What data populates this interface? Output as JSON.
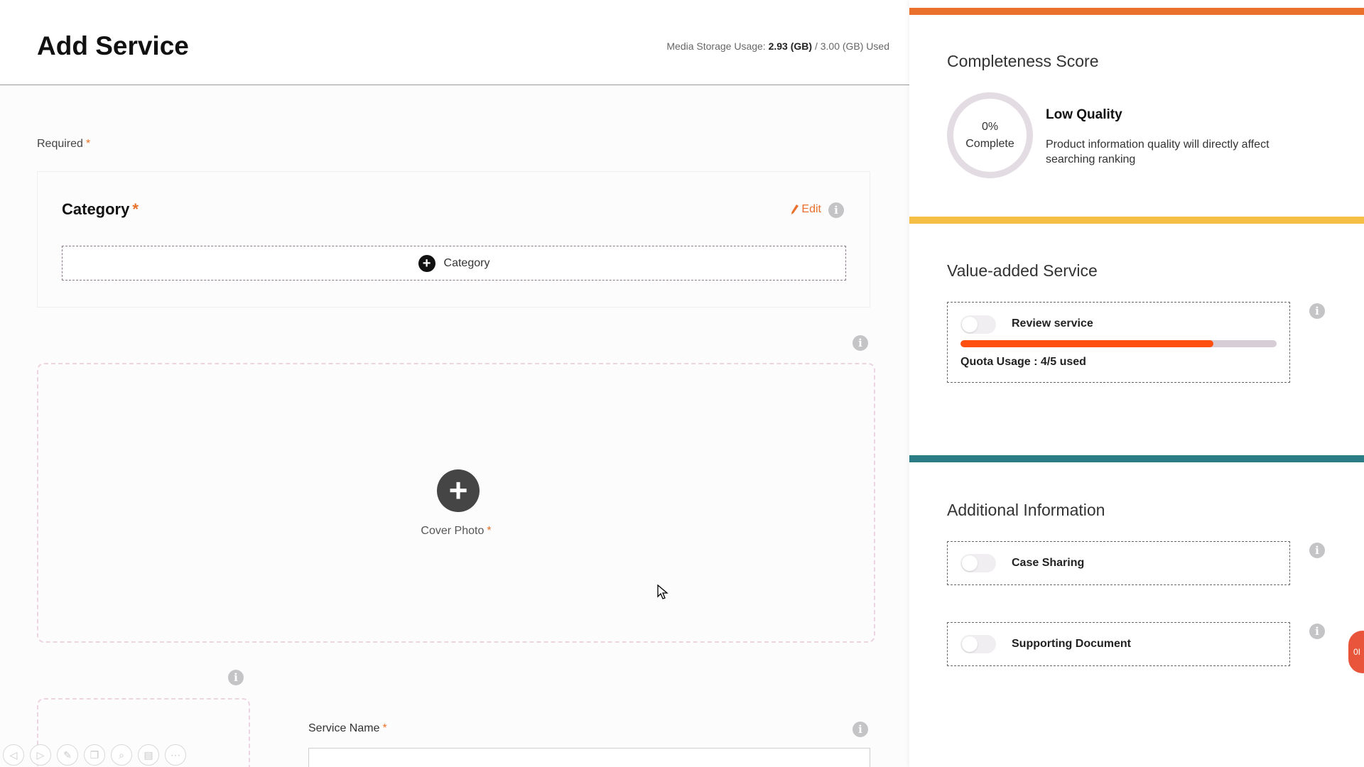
{
  "header": {
    "title": "Add Service",
    "storage_label": "Media Storage Usage: ",
    "storage_used": "2.93 (GB)",
    "storage_total": " / 3.00 (GB) Used"
  },
  "form": {
    "required_label": "Required",
    "required_star": "*",
    "category": {
      "title": "Category",
      "edit_label": "Edit",
      "add_label": "Category"
    },
    "cover_photo_label": "Cover Photo",
    "service_name_label": "Service Name"
  },
  "icons": {
    "info": "info-icon",
    "plus": "plus-icon",
    "pencil": "pencil-icon"
  },
  "sidebar": {
    "completeness": {
      "title": "Completeness Score",
      "percent": "0%",
      "complete_label": "Complete",
      "quality_title": "Low Quality",
      "quality_desc": "Product information quality will directly affect searching ranking"
    },
    "value_added": {
      "title": "Value-added Service",
      "review_label": "Review service",
      "quota_text": "Quota Usage : 4/5 used",
      "quota_fraction": 0.8
    },
    "additional": {
      "title": "Additional Information",
      "case_sharing_label": "Case Sharing",
      "supporting_doc_label": "Supporting Document"
    },
    "side_bubble_text": "0I"
  },
  "colors": {
    "accent_orange": "#e8702a",
    "accent_yellow": "#f5be45",
    "accent_teal": "#2a7c85",
    "progress_fill": "#ff4f0f"
  }
}
